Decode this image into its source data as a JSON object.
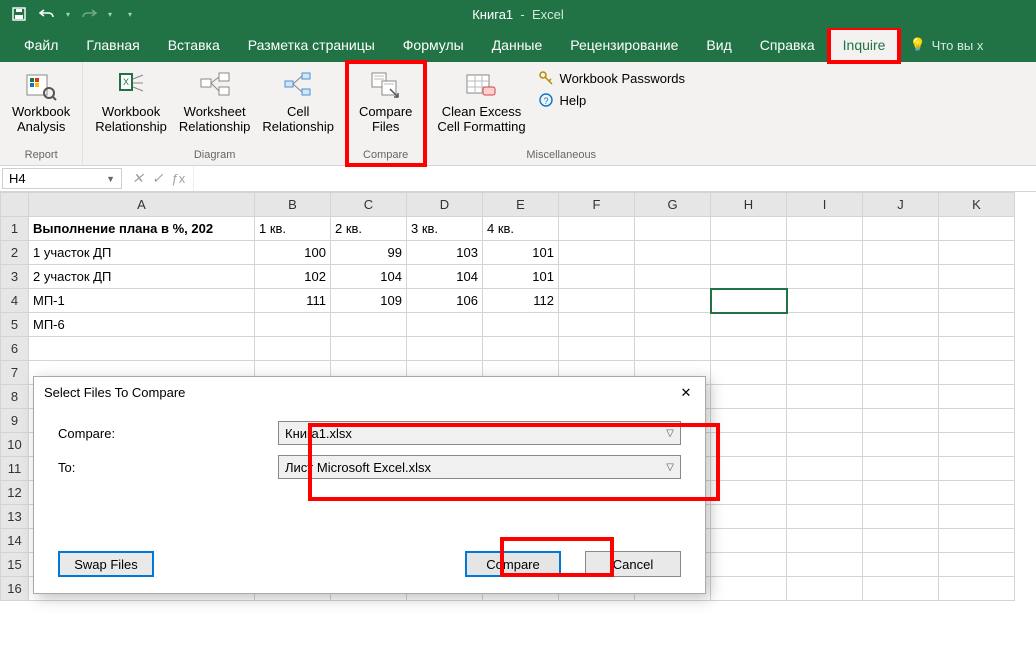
{
  "title": {
    "book": "Книга1",
    "app": "Excel"
  },
  "tabs": {
    "file": "Файл",
    "home": "Главная",
    "insert": "Вставка",
    "pagelayout": "Разметка страницы",
    "formulas": "Формулы",
    "data": "Данные",
    "review": "Рецензирование",
    "view": "Вид",
    "help": "Справка",
    "inquire": "Inquire",
    "tellme": "Что вы х"
  },
  "ribbon": {
    "report": {
      "label": "Report",
      "workbook_analysis": "Workbook\nAnalysis"
    },
    "diagram": {
      "label": "Diagram",
      "workbook_rel": "Workbook\nRelationship",
      "worksheet_rel": "Worksheet\nRelationship",
      "cell_rel": "Cell\nRelationship"
    },
    "compare": {
      "label": "Compare",
      "compare_files": "Compare\nFiles"
    },
    "misc": {
      "label": "Miscellaneous",
      "clean": "Clean Excess\nCell Formatting",
      "passwords": "Workbook Passwords",
      "help": "Help"
    }
  },
  "namebox": "H4",
  "columns": [
    "A",
    "B",
    "C",
    "D",
    "E",
    "F",
    "G",
    "H",
    "I",
    "J",
    "K"
  ],
  "sheet": {
    "header": {
      "title": "Выполнение плана в %, 202",
      "q1": "1 кв.",
      "q2": "2 кв.",
      "q3": "3 кв.",
      "q4": "4 кв."
    },
    "rows": [
      {
        "n": "2",
        "name": "1 участок ДП",
        "v": [
          100,
          99,
          103,
          101
        ]
      },
      {
        "n": "3",
        "name": "2 участок ДП",
        "v": [
          102,
          104,
          104,
          101
        ]
      },
      {
        "n": "4",
        "name": "МП-1",
        "v": [
          111,
          109,
          106,
          112
        ]
      }
    ],
    "row5_name": "МП-6",
    "blank_rows": [
      "6",
      "7",
      "8",
      "9",
      "10",
      "11",
      "12",
      "13",
      "14",
      "15",
      "16"
    ]
  },
  "dialog": {
    "title": "Select Files To Compare",
    "compare_label": "Compare:",
    "to_label": "To:",
    "compare_value": "Книга1.xlsx",
    "to_value": "Лист Microsoft Excel.xlsx",
    "swap": "Swap Files",
    "ok": "Compare",
    "cancel": "Cancel"
  }
}
